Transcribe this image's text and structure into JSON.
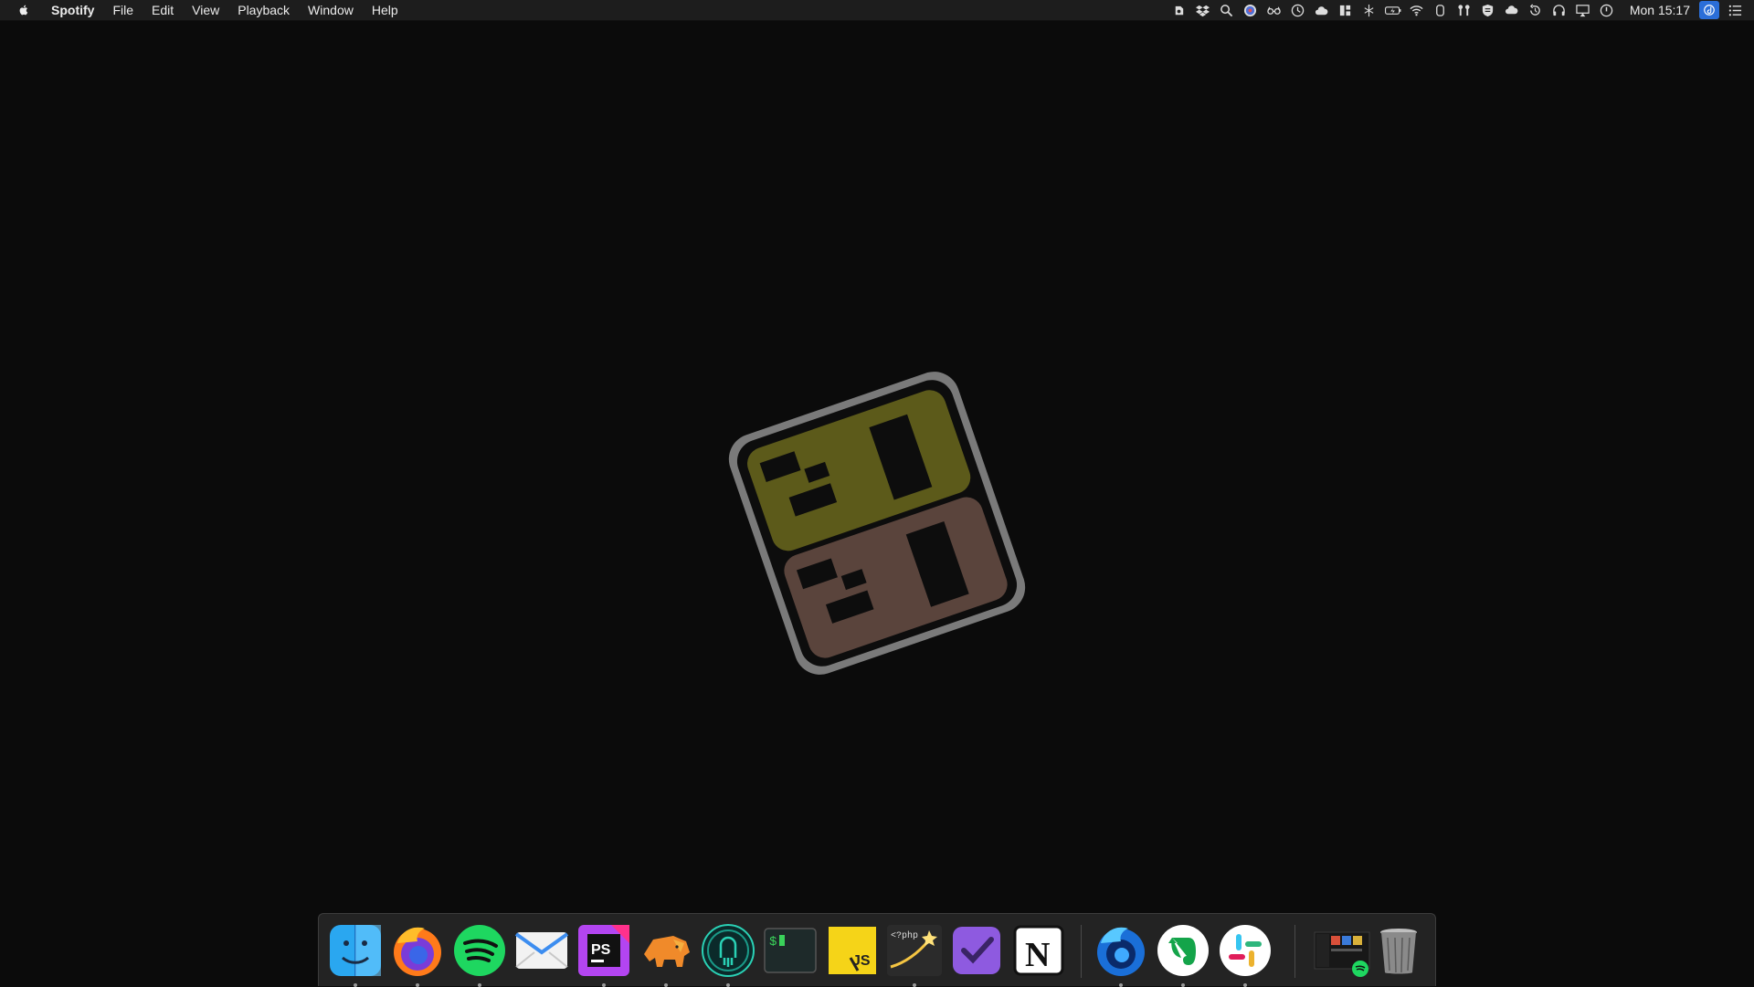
{
  "menubar": {
    "apple_icon": "apple-logo-icon",
    "app_name": "Spotify",
    "menus": [
      "File",
      "Edit",
      "View",
      "Playback",
      "Window",
      "Help"
    ],
    "clock": "Mon 15:17",
    "status_icons": [
      "evernote-helper-icon",
      "dropbox-icon",
      "search-icon",
      "color-picker-icon",
      "glasses-icon",
      "clock-icon",
      "cloud-icon",
      "grid-icon",
      "scissors-icon",
      "battery-icon",
      "wifi-icon",
      "cylinder-icon",
      "airpods-icon",
      "shield-icon",
      "icloud-icon",
      "time-machine-icon",
      "headphones-icon",
      "airplay-icon",
      "power-icon"
    ]
  },
  "desktop": {
    "wallpaper": "2020",
    "logo_colors": {
      "top": "#5c5a1a",
      "bottom": "#5a443c",
      "outline": "#7a7a7a"
    }
  },
  "dock": {
    "items": [
      {
        "name": "Finder",
        "icon": "finder-icon",
        "running": true
      },
      {
        "name": "Firefox",
        "icon": "firefox-icon",
        "running": true
      },
      {
        "name": "Spotify",
        "icon": "spotify-icon",
        "running": true
      },
      {
        "name": "Mail",
        "icon": "mail-icon",
        "running": false
      },
      {
        "name": "PhpStorm",
        "icon": "phpstorm-icon",
        "running": true
      },
      {
        "name": "TablePlus",
        "icon": "tableplus-elephant-icon",
        "running": true
      },
      {
        "name": "GitKraken",
        "icon": "gitkraken-icon",
        "running": true
      },
      {
        "name": "Terminal",
        "icon": "terminal-icon",
        "running": false
      },
      {
        "name": "RunJS",
        "icon": "runjs-icon",
        "running": false
      },
      {
        "name": "Tinkerwell",
        "icon": "tinkerwell-icon",
        "running": true
      },
      {
        "name": "OmniFocus",
        "icon": "omnifocus-icon",
        "running": false
      },
      {
        "name": "Notion",
        "icon": "notion-icon",
        "running": false
      },
      {
        "name": "Firefox Developer Edition",
        "icon": "firefox-developer-icon",
        "running": true
      },
      {
        "name": "Evernote",
        "icon": "evernote-icon",
        "running": true
      },
      {
        "name": "Slack",
        "icon": "slack-icon",
        "running": true
      },
      {
        "name": "Spotify Window",
        "icon": "spotify-window-thumbnail-icon",
        "running": false
      },
      {
        "name": "Trash",
        "icon": "trash-icon",
        "running": false
      }
    ],
    "terminal_prompt": "$",
    "tinkerwell_label": "<?php",
    "phpstorm_label": "PS",
    "runjs_label": "JS",
    "notion_label": "N"
  }
}
